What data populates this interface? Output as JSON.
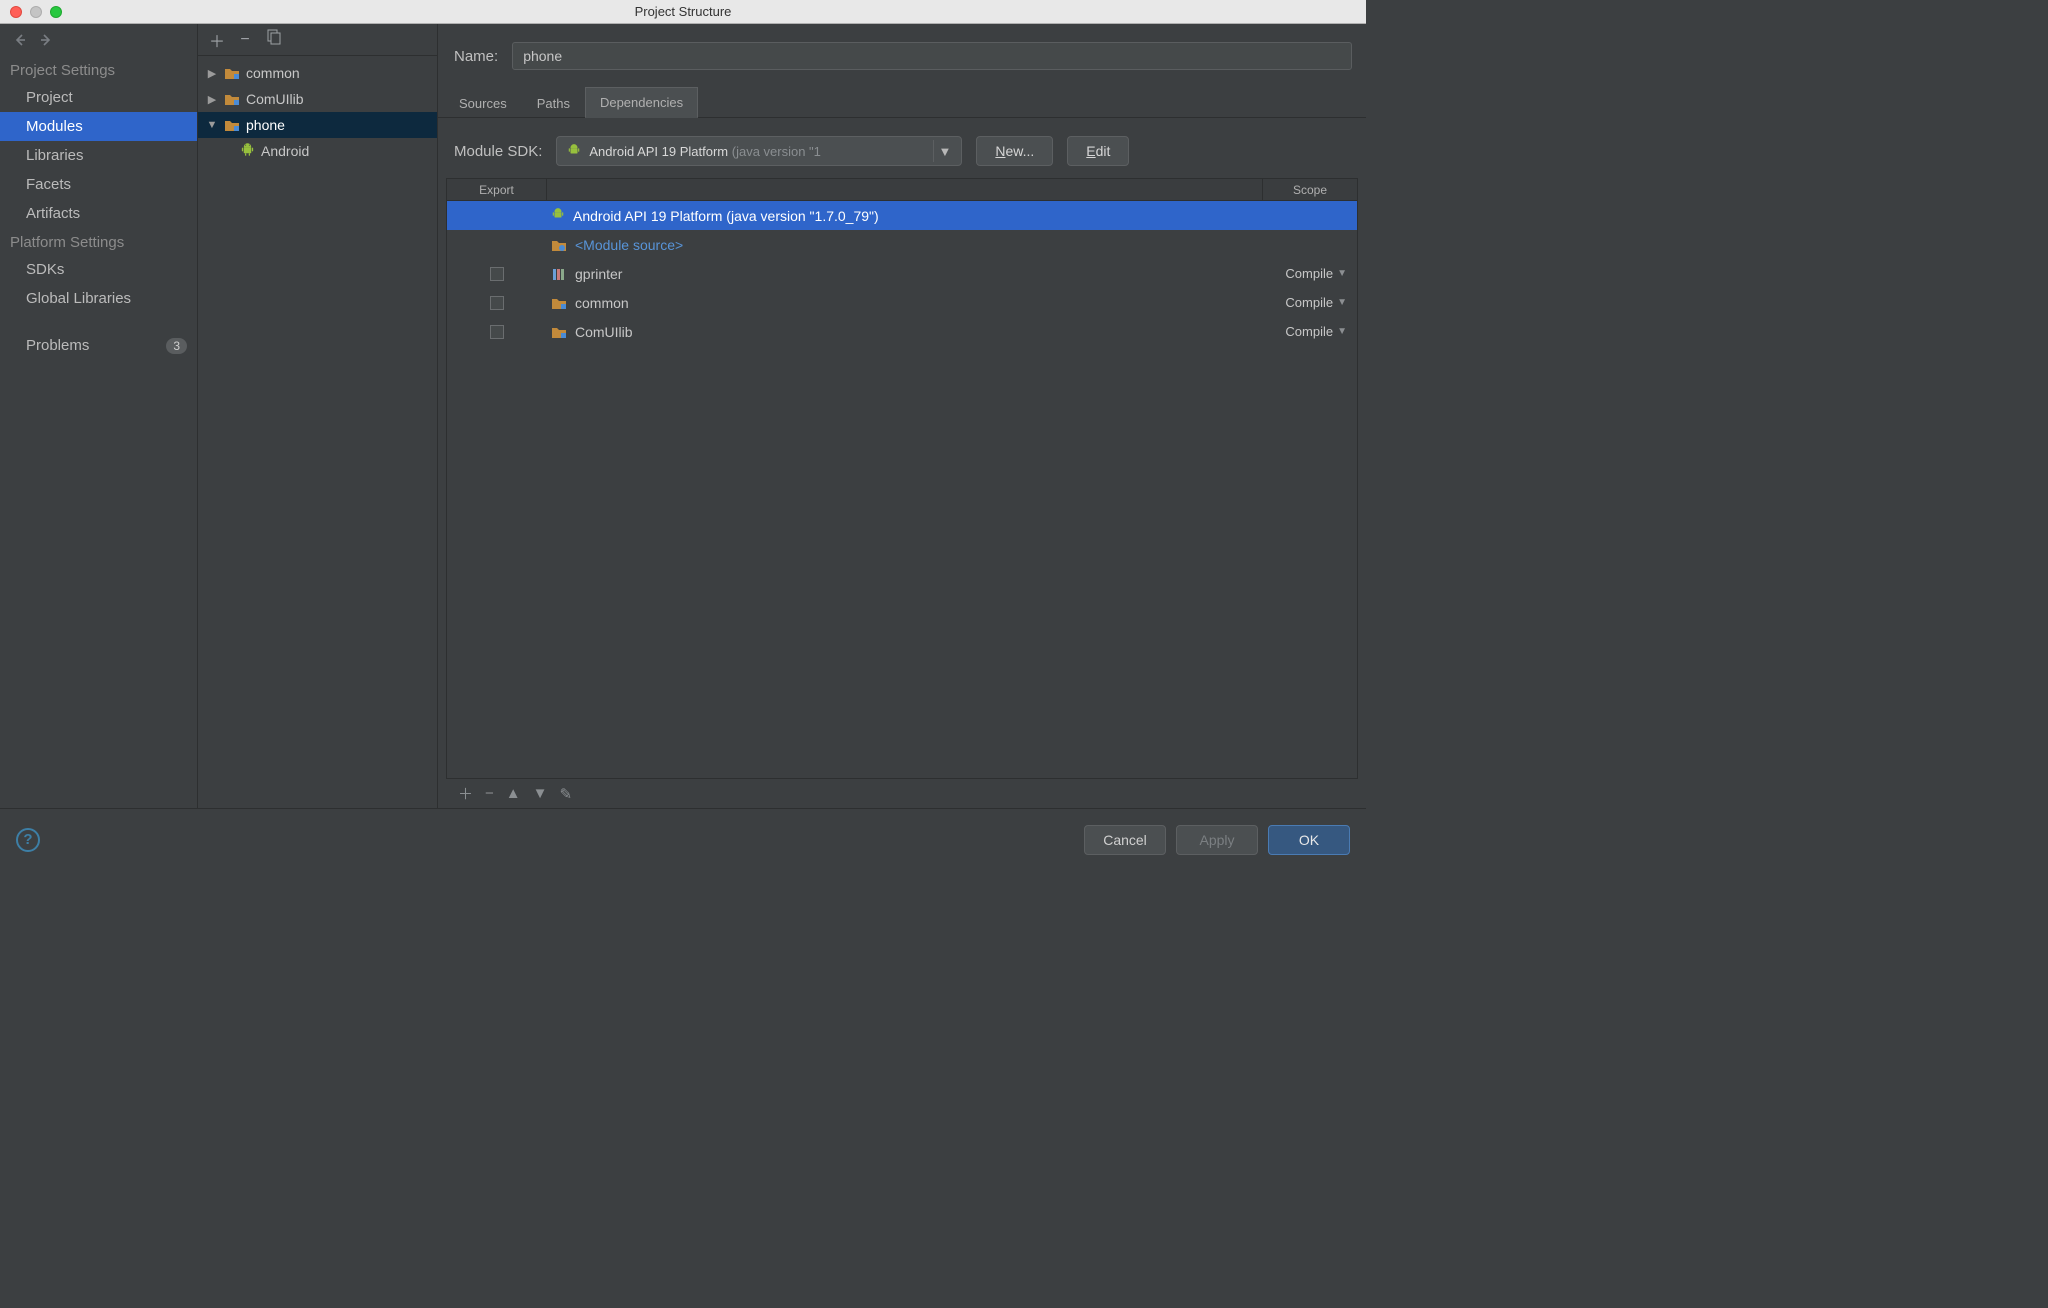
{
  "window": {
    "title": "Project Structure"
  },
  "sidebar": {
    "sections": [
      {
        "heading": "Project Settings",
        "items": [
          {
            "label": "Project"
          },
          {
            "label": "Modules",
            "selected": true
          },
          {
            "label": "Libraries"
          },
          {
            "label": "Facets"
          },
          {
            "label": "Artifacts"
          }
        ]
      },
      {
        "heading": "Platform Settings",
        "items": [
          {
            "label": "SDKs"
          },
          {
            "label": "Global Libraries"
          }
        ]
      }
    ],
    "problems": {
      "label": "Problems",
      "count": "3"
    }
  },
  "tree": {
    "items": [
      {
        "label": "common",
        "expandable": true,
        "expanded": false
      },
      {
        "label": "ComUIlib",
        "expandable": true,
        "expanded": false
      },
      {
        "label": "phone",
        "expandable": true,
        "expanded": true,
        "selected": true,
        "children": [
          {
            "label": "Android",
            "icon": "android"
          }
        ]
      }
    ]
  },
  "main": {
    "name_label": "Name:",
    "name_value": "phone",
    "tabs": [
      {
        "label": "Sources"
      },
      {
        "label": "Paths"
      },
      {
        "label": "Dependencies",
        "active": true
      }
    ],
    "sdk_label": "Module SDK:",
    "sdk_select": {
      "main": "Android API 19 Platform",
      "sub": "(java version \"1"
    },
    "new_button": "New...",
    "edit_button": "Edit",
    "dep_header": {
      "export": "Export",
      "scope": "Scope"
    },
    "dependencies": [
      {
        "icon": "android",
        "label": "Android API 19 Platform (java version \"1.7.0_79\")",
        "selected": true,
        "export": null,
        "scope": null
      },
      {
        "icon": "module-source",
        "label": "<Module source>",
        "link": true,
        "export": null,
        "scope": null
      },
      {
        "icon": "lib",
        "label": "gprinter",
        "export": false,
        "scope": "Compile"
      },
      {
        "icon": "module",
        "label": "common",
        "export": false,
        "scope": "Compile"
      },
      {
        "icon": "module",
        "label": "ComUIlib",
        "export": false,
        "scope": "Compile"
      }
    ]
  },
  "buttons": {
    "cancel": "Cancel",
    "apply": "Apply",
    "ok": "OK"
  }
}
